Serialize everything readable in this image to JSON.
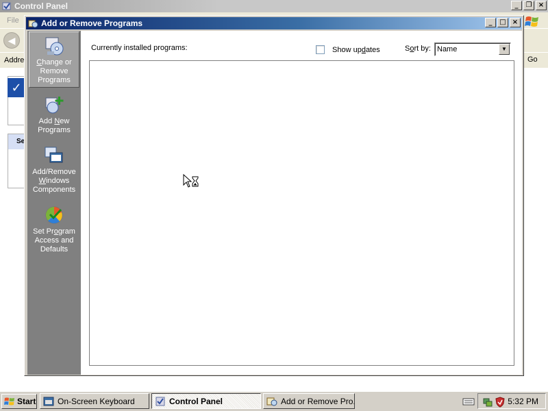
{
  "background_window": {
    "title": "Control Panel",
    "menu_file": "File",
    "address_label": "Addre",
    "go_label": "Go",
    "panel_header_partial": "Se"
  },
  "arp_window": {
    "title": "Add or Remove Programs",
    "sidebar": [
      {
        "id": "change-remove",
        "label_hk": "C",
        "label_rest": "hange or Remove Programs",
        "selected": true
      },
      {
        "id": "add-new",
        "label_pre": "Add ",
        "label_hk": "N",
        "label_rest": "ew Programs",
        "selected": false
      },
      {
        "id": "windows-components",
        "label_pre": "Add/Remove ",
        "label_hk": "W",
        "label_rest": "indows Components",
        "selected": false
      },
      {
        "id": "program-access",
        "label_pre": "Set Pr",
        "label_hk": "o",
        "label_rest": "gram Access and Defaults",
        "selected": false
      }
    ],
    "installed_label": "Currently installed programs:",
    "show_updates_label_pre": "Show up",
    "show_updates_label_hk": "d",
    "show_updates_label_rest": "ates",
    "show_updates_checked": false,
    "sort_label_pre": "S",
    "sort_label_hk": "o",
    "sort_label_rest": "rt by:",
    "sort_value": "Name"
  },
  "taskbar": {
    "start_label": "Start",
    "tasks": [
      {
        "label": "On-Screen Keyboard",
        "active": false
      },
      {
        "label": "Control Panel",
        "active": true
      },
      {
        "label": "Add or Remove Pro...",
        "active": false
      }
    ],
    "clock": "5:32 PM"
  },
  "colors": {
    "title_active_start": "#0a246a",
    "title_active_end": "#a6caf0",
    "sidebar_bg": "#808080",
    "face": "#d4d0c8"
  }
}
